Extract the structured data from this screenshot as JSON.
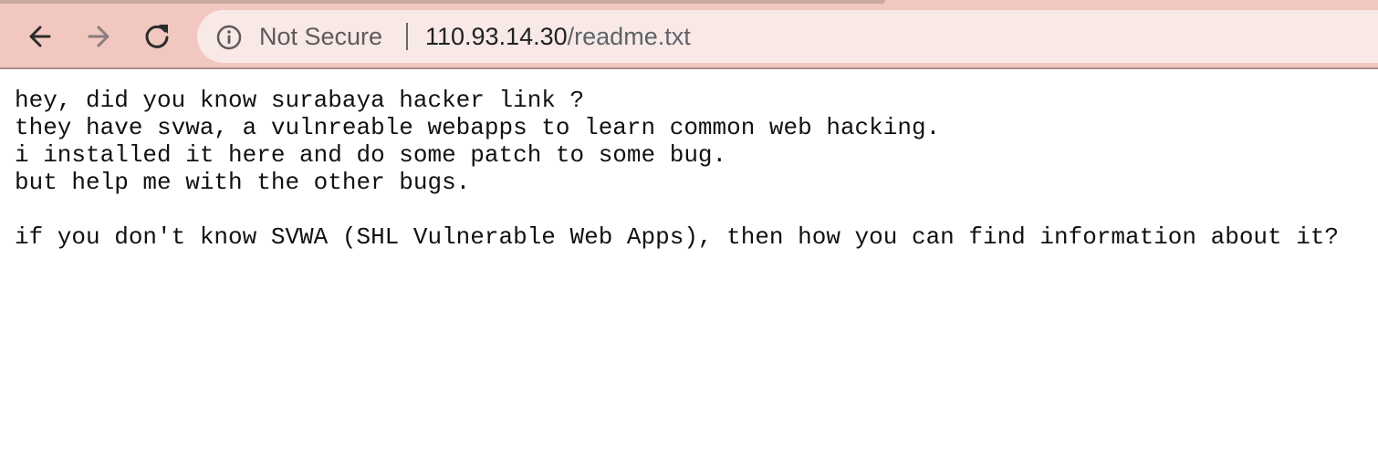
{
  "browser": {
    "back_icon": "arrow-left-icon",
    "forward_icon": "arrow-right-icon",
    "reload_icon": "reload-icon",
    "site_info_icon": "info-circle-icon",
    "security_label": "Not Secure",
    "url_host": "110.93.14.30",
    "url_path": "/readme.txt",
    "colors": {
      "toolbar": "#f1c7c0",
      "omnibox": "#f8e9e7"
    }
  },
  "document": {
    "lines": [
      "hey, did you know surabaya hacker link ?",
      "they have svwa, a vulnreable webapps to learn common web hacking.",
      "i installed it here and do some patch to some bug.",
      "but help me with the other bugs.",
      "",
      "if you don't know SVWA (SHL Vulnerable Web Apps), then how you can find information about it?"
    ]
  }
}
